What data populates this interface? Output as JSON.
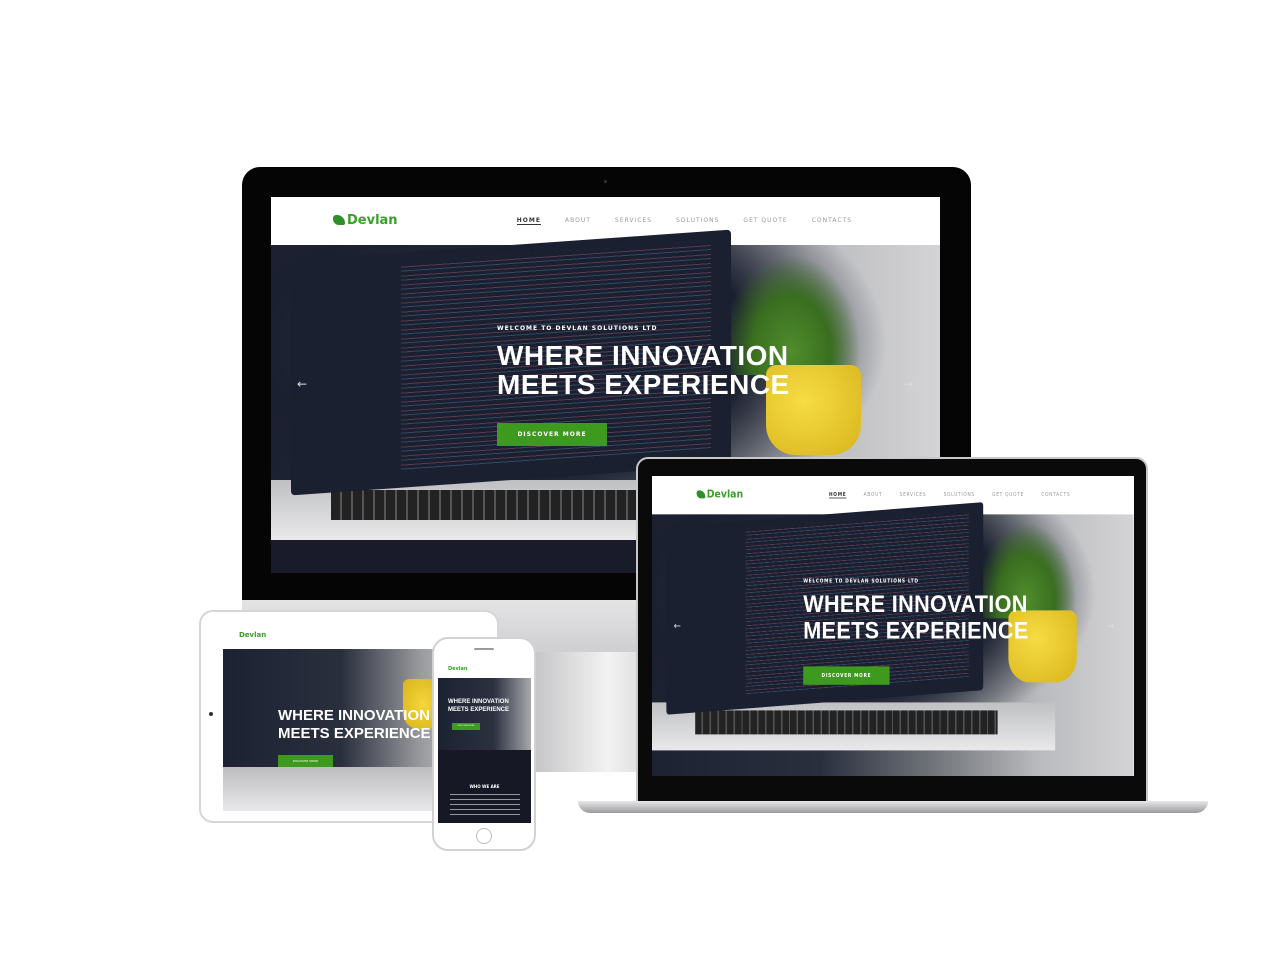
{
  "site": {
    "brand": "Devlan",
    "nav": [
      "HOME",
      "ABOUT",
      "SERVICES",
      "SOLUTIONS",
      "GET QUOTE",
      "CONTACTS"
    ],
    "kicker": "WELCOME TO DEVLAN SOLUTIONS LTD",
    "headline_1": "WHERE INNOVATION",
    "headline_2": "MEETS EXPERIENCE",
    "cta": "DISCOVER MORE",
    "prev": "←",
    "next": "→",
    "section_title": "WHO WE ARE"
  },
  "colors": {
    "accent": "#3d9a1f",
    "dark": "#161826"
  }
}
